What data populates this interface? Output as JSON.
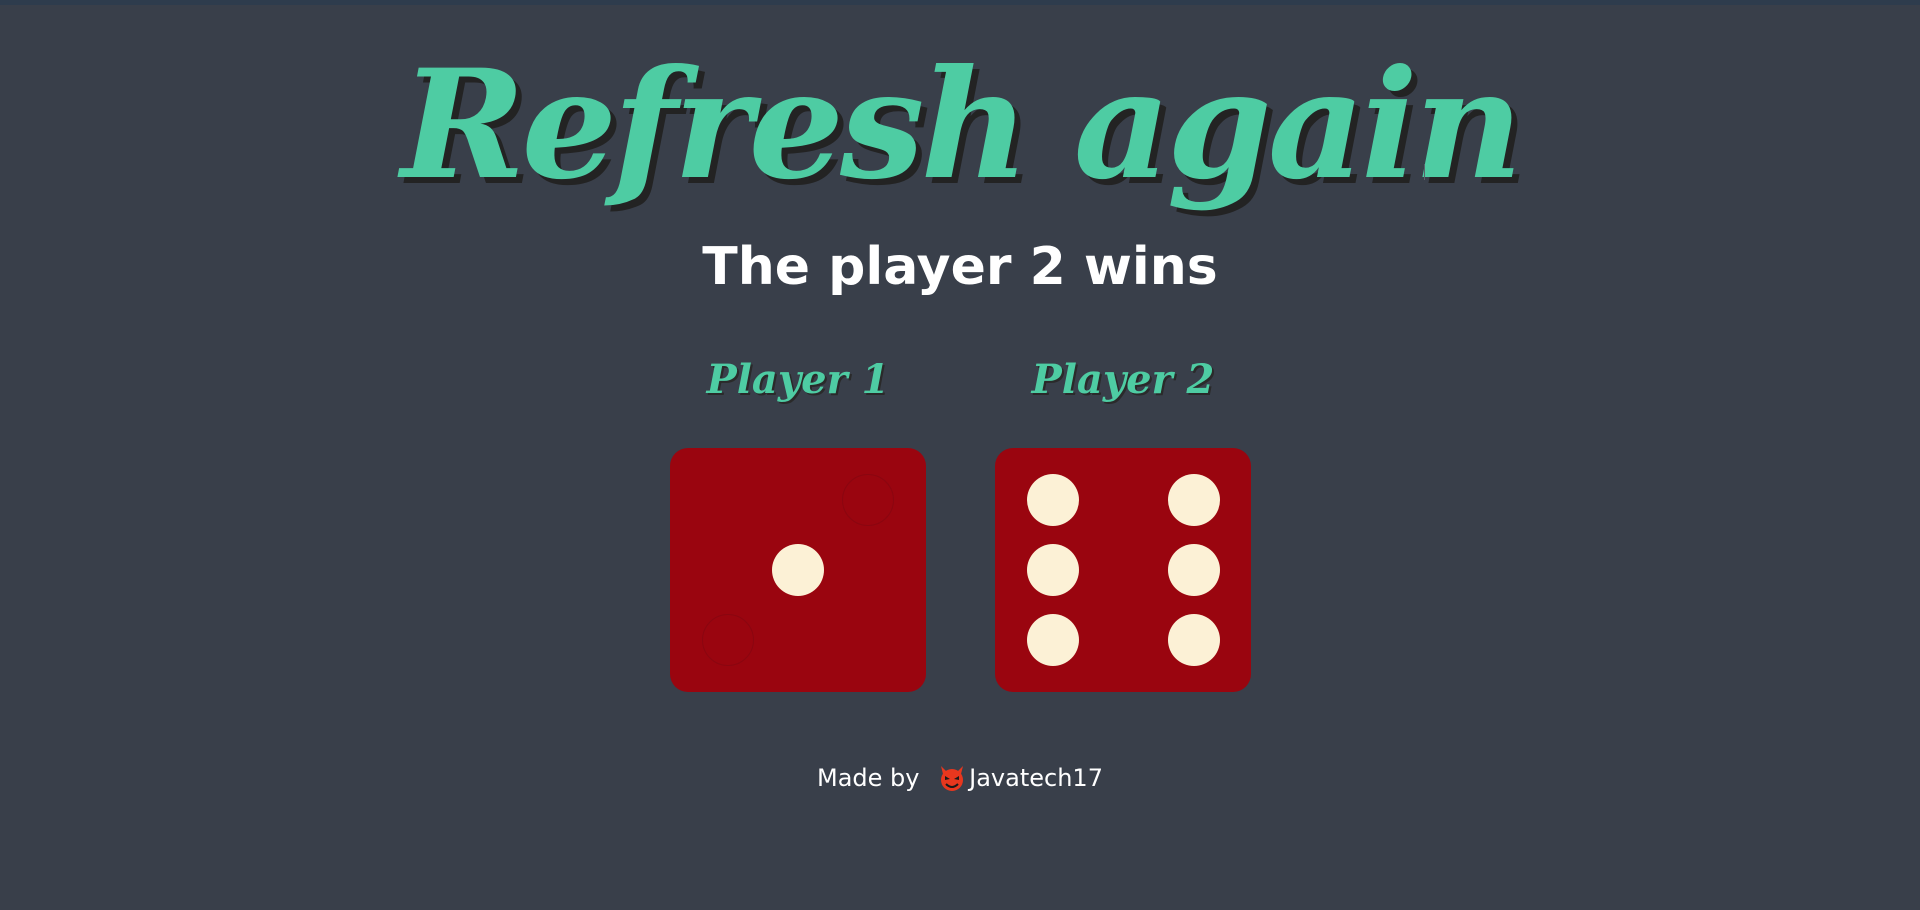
{
  "title": "Refresh again",
  "result": "The player 2 wins",
  "players": [
    {
      "label": "Player 1",
      "die_value": 1
    },
    {
      "label": "Player 2",
      "die_value": 6
    }
  ],
  "footer": {
    "prefix": "Made by",
    "icon": "devil-face-icon",
    "author": "Javatech17"
  },
  "colors": {
    "background": "#393f4a",
    "accent": "#4ecca3",
    "die_face": "#9a050f",
    "pip": "#fcf1d6"
  }
}
